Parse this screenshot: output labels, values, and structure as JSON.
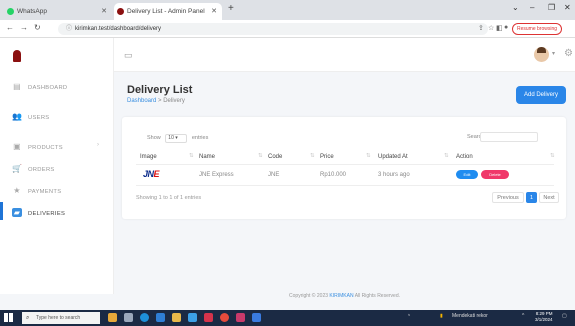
{
  "browser": {
    "tabs": [
      {
        "label": "WhatsApp"
      },
      {
        "label": "Delivery List - Admin Panel"
      }
    ],
    "url": "kirimkan.test/dashboard/delivery",
    "resume_label": "Resume browsing"
  },
  "sidebar": {
    "items": [
      {
        "label": "DASHBOARD",
        "icon": "dashboard-icon"
      },
      {
        "label": "USERS",
        "icon": "users-icon"
      },
      {
        "label": "PRODUCTS",
        "icon": "products-icon"
      },
      {
        "label": "ORDERS",
        "icon": "cart-icon"
      },
      {
        "label": "PAYMENTS",
        "icon": "star-icon"
      },
      {
        "label": "DELIVERIES",
        "icon": "truck-icon"
      }
    ],
    "active": "DELIVERIES",
    "accent": "#1f74d6"
  },
  "page": {
    "title": "Delivery List",
    "breadcrumb": {
      "home": "Dashboard",
      "sep": ">",
      "current": "Delivery"
    },
    "add_button": "Add Delivery"
  },
  "table": {
    "show_label": "Show",
    "entries_value": "10",
    "entries_label": "entries",
    "search_label": "Search:",
    "columns": [
      "Image",
      "Name",
      "Code",
      "Price",
      "Updated At",
      "Action"
    ],
    "rows": [
      {
        "image": "JNE",
        "name": "JNE Express",
        "code": "JNE",
        "price": "Rp10.000",
        "updated": "3 hours ago"
      }
    ],
    "edit_label": "Edit",
    "delete_label": "Delete",
    "showing": "Showing 1 to 1 of 1 entries",
    "pagination": {
      "prev": "Previous",
      "page": "1",
      "next": "Next"
    }
  },
  "footer": {
    "prefix": "Copyright © 2023",
    "brand": "KIRIMKAN",
    "suffix": "All Rights Reserved."
  },
  "taskbar": {
    "search_placeholder": "Type here to search",
    "weather": "Mendekati rekor",
    "time": "8:29 PM",
    "date": "3/1/2024"
  }
}
